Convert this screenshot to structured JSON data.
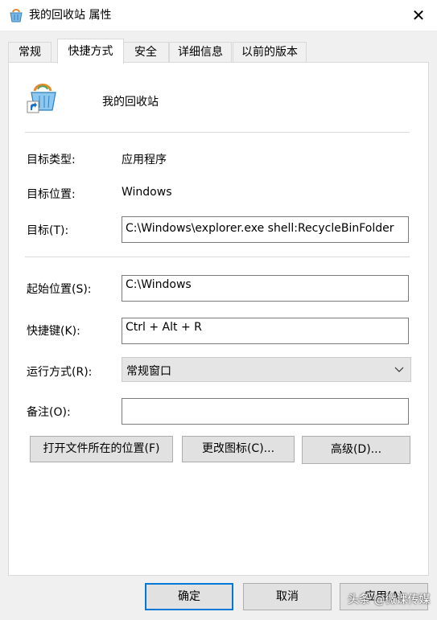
{
  "window": {
    "title": "我的回收站 属性",
    "close_label": "✕"
  },
  "tabs": [
    {
      "label": "常规",
      "active": false
    },
    {
      "label": "快捷方式",
      "active": true
    },
    {
      "label": "安全",
      "active": false
    },
    {
      "label": "详细信息",
      "active": false
    },
    {
      "label": "以前的版本",
      "active": false
    }
  ],
  "shortcut": {
    "name": "我的回收站",
    "icon": "recycle-bin-shortcut-icon"
  },
  "fields": {
    "target_type_label": "目标类型:",
    "target_type_value": "应用程序",
    "target_location_label": "目标位置:",
    "target_location_value": "Windows",
    "target_label": "目标(T):",
    "target_value": "C:\\Windows\\explorer.exe shell:RecycleBinFolder",
    "start_in_label": "起始位置(S):",
    "start_in_value": "C:\\Windows",
    "hotkey_label": "快捷键(K):",
    "hotkey_value": "Ctrl + Alt + R",
    "run_label": "运行方式(R):",
    "run_value": "常规窗口",
    "comment_label": "备注(O):",
    "comment_value": ""
  },
  "actions": {
    "open_location": "打开文件所在的位置(F)",
    "change_icon": "更改图标(C)...",
    "advanced": "高级(D)..."
  },
  "footer": {
    "ok": "确定",
    "cancel": "取消",
    "apply": "应用(A)"
  },
  "watermark": "头条 @微课传媒",
  "colors": {
    "accent": "#0078d7",
    "panel_bg": "#ffffff",
    "window_bg": "#f0f0f0"
  }
}
